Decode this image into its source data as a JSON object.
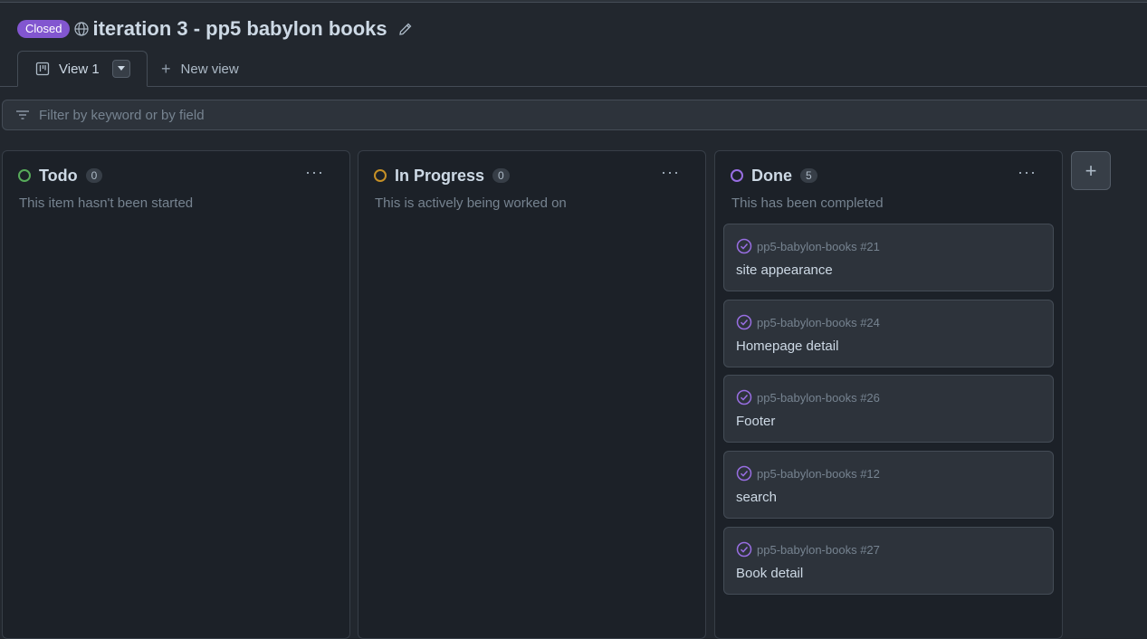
{
  "project": {
    "state_badge": "Closed",
    "title": "iteration 3 - pp5 babylon books"
  },
  "tabs": {
    "active_label": "View 1",
    "new_view_label": "New view"
  },
  "filter": {
    "placeholder": "Filter by keyword or by field"
  },
  "columns": [
    {
      "name": "Todo",
      "count": "0",
      "description": "This item hasn't been started",
      "color": "#57ab5a",
      "cards": []
    },
    {
      "name": "In Progress",
      "count": "0",
      "description": "This is actively being worked on",
      "color": "#c69026",
      "cards": []
    },
    {
      "name": "Done",
      "count": "5",
      "description": "This has been completed",
      "color": "#986ee2",
      "cards": [
        {
          "repo": "pp5-babylon-books #21",
          "title": "site appearance"
        },
        {
          "repo": "pp5-babylon-books #24",
          "title": "Homepage detail"
        },
        {
          "repo": "pp5-babylon-books #26",
          "title": "Footer"
        },
        {
          "repo": "pp5-babylon-books #12",
          "title": "search"
        },
        {
          "repo": "pp5-babylon-books #27",
          "title": "Book detail"
        }
      ]
    }
  ],
  "icons": {
    "visibility": "globe-icon",
    "edit": "pencil-icon",
    "view_layout": "board-icon",
    "filter": "filter-icon",
    "card_status": "issue-closed-check-icon",
    "column_menu": "kebab-horizontal-icon",
    "add_column": "plus-icon"
  },
  "colors": {
    "background": "#22272e",
    "closed_badge": "#8256d0",
    "done_check": "#986ee2"
  }
}
